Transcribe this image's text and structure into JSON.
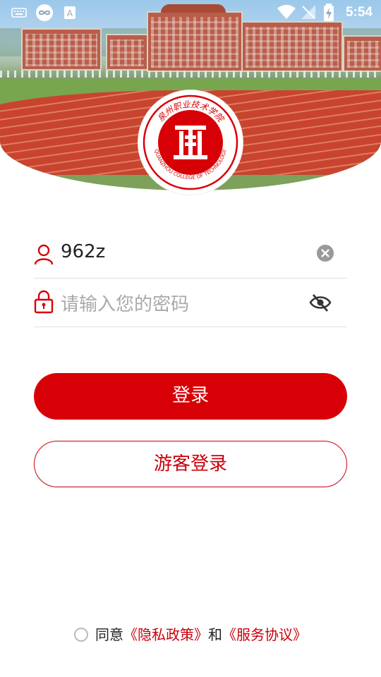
{
  "status_bar": {
    "time": "5:54"
  },
  "logo": {
    "name_cn": "泉州职业技术学院",
    "name_en": "QUANZHOU COLLEGE OF TECHNOLOGY",
    "brand_color": "#d80007"
  },
  "form": {
    "username_value": "962z",
    "password_placeholder": "请输入您的密码"
  },
  "buttons": {
    "login_label": "登录",
    "guest_login_label": "游客登录"
  },
  "agreement": {
    "prefix": "同意",
    "privacy_link": "《隐私政策》",
    "conjunction": "和",
    "service_link": "《服务协议》"
  },
  "icons": {
    "status_left": [
      "keyboard-icon",
      "infinity-icon",
      "translate-icon"
    ],
    "status_right": [
      "wifi-icon",
      "signal-off-icon",
      "battery-charging-icon"
    ],
    "username": "user-icon",
    "password": "lock-icon",
    "clear": "clear-icon",
    "visibility": "eye-off-icon"
  }
}
